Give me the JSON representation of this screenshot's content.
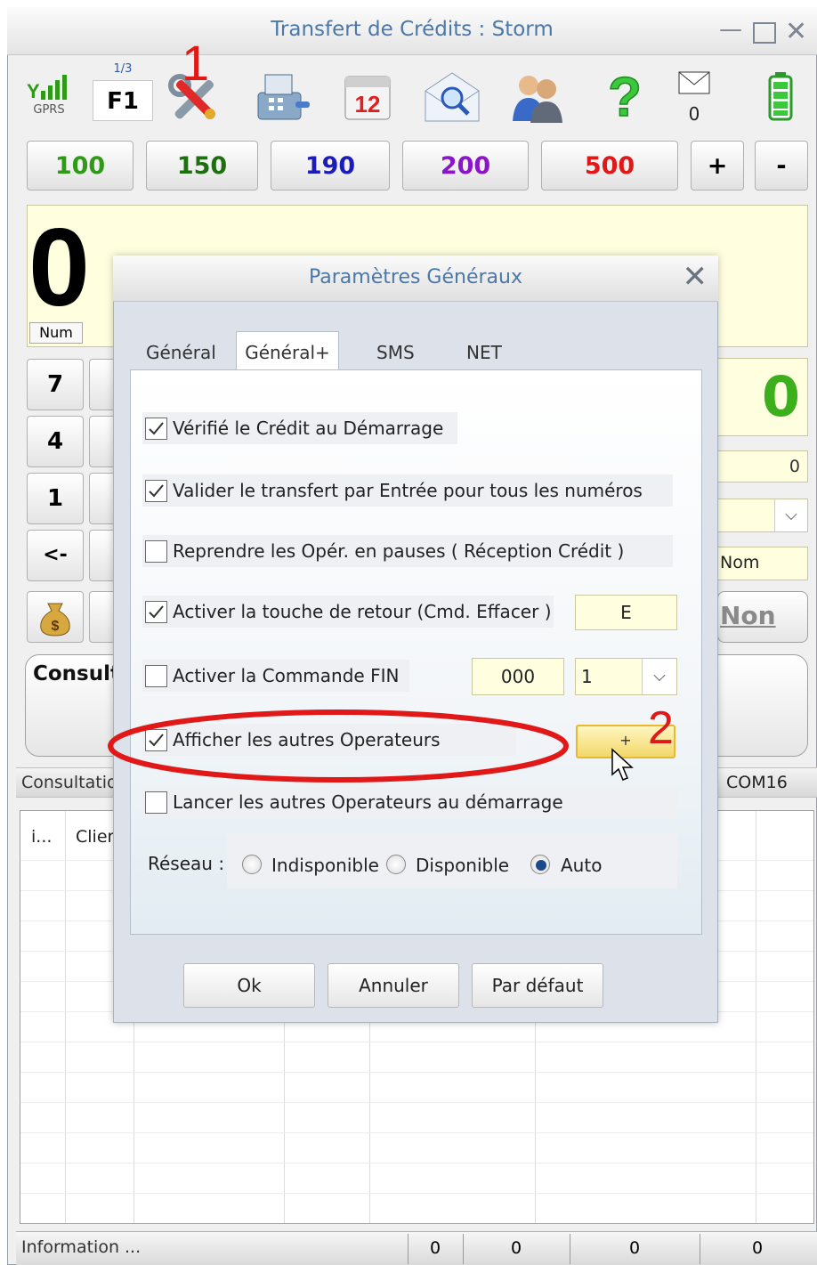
{
  "window": {
    "title": "Transfert de Crédits : Storm"
  },
  "toolbar": {
    "signal_label": "GPRS",
    "page_indicator": "1/3",
    "function_key": "F1",
    "mail_count": "0",
    "annotation_1": "1"
  },
  "amount_buttons": [
    {
      "label": "100",
      "color": "#2e9a16"
    },
    {
      "label": "150",
      "color": "#1f6e12"
    },
    {
      "label": "190",
      "color": "#1c1cb8"
    },
    {
      "label": "200",
      "color": "#8b16c8"
    },
    {
      "label": "500",
      "color": "#e01818"
    },
    {
      "label": "+",
      "color": "#111111"
    },
    {
      "label": "-",
      "color": "#111111"
    }
  ],
  "display": {
    "value": "0",
    "mode": "Num"
  },
  "keypad": {
    "k7": "7",
    "k4": "4",
    "k1": "1",
    "back": "<-"
  },
  "right_panel": {
    "total": "0",
    "field_value": "0",
    "nom_label": "Nom",
    "non_button": "Non"
  },
  "consult": {
    "label": "Consult",
    "strip_label": "Consultatio",
    "port": "COM16"
  },
  "grid": {
    "col1": "i...",
    "col2": "Clier"
  },
  "statusbar": {
    "info": "Information ...",
    "c1": "0",
    "c2": "0",
    "c3": "0",
    "c4": "0"
  },
  "dialog": {
    "title": "Paramètres Généraux",
    "tabs": [
      {
        "label": "Général"
      },
      {
        "label": "Général+"
      },
      {
        "label": "SMS"
      },
      {
        "label": "NET"
      }
    ],
    "options": [
      {
        "label": "Vérifié le Crédit au Démarrage",
        "checked": true
      },
      {
        "label": "Valider le transfert par Entrée pour tous les numéros",
        "checked": true
      },
      {
        "label": "Reprendre les Opér. en pauses ( Réception Crédit )",
        "checked": false
      },
      {
        "label": "Activer la touche de retour (Cmd. Effacer )",
        "checked": true
      },
      {
        "label": "Activer la Commande FIN",
        "checked": false
      },
      {
        "label": "Afficher les autres Operateurs",
        "checked": true
      },
      {
        "label": "Lancer les  autres Operateurs au démarrage",
        "checked": false
      }
    ],
    "retour_key_value": "E",
    "fin_code_value": "000",
    "fin_select_value": "1",
    "plus_button": "+",
    "annotation_2": "2",
    "network": {
      "label": "Réseau :",
      "options": [
        {
          "label": "Indisponible",
          "selected": false
        },
        {
          "label": "Disponible",
          "selected": false
        },
        {
          "label": "Auto",
          "selected": true
        }
      ]
    },
    "buttons": {
      "ok": "Ok",
      "cancel": "Annuler",
      "default": "Par défaut"
    }
  }
}
